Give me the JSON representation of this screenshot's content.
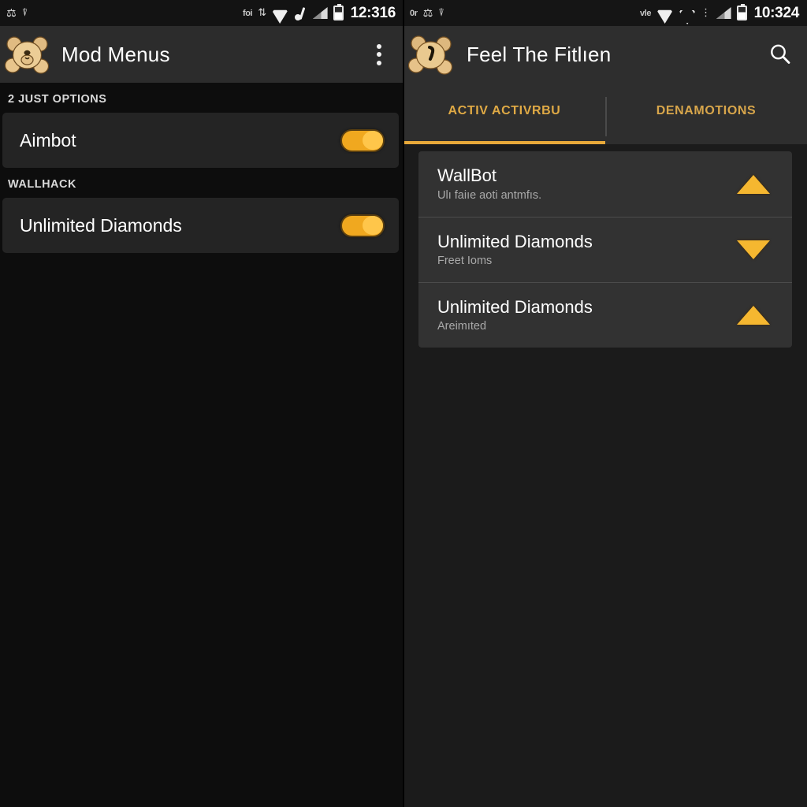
{
  "left_panel": {
    "status_bar": {
      "left_icons": [
        "usb-icon",
        "screenshot-icon"
      ],
      "right_icons": [
        "notification-glyph",
        "sync-icon",
        "wifi-icon",
        "bluetooth-icon",
        "signal-icon",
        "battery-icon"
      ],
      "notification_text": "foi",
      "clock": "12:316"
    },
    "app_bar": {
      "icon": "teddy-bear-icon",
      "title": "Mod Menus",
      "overflow_icon": "overflow-menu-icon"
    },
    "sections": [
      {
        "header": "2 JUST OPTIONS",
        "items": [
          {
            "label": "Aimbot",
            "toggle_on": true
          }
        ]
      },
      {
        "header": "WALLHACK",
        "items": [
          {
            "label": "Unlimited Diamonds",
            "toggle_on": true
          }
        ]
      }
    ]
  },
  "right_panel": {
    "status_bar": {
      "left_icons": [
        "usb-icon",
        "screenshot-icon"
      ],
      "left_text": "0r",
      "right_icons": [
        "notification-glyph",
        "wifi-icon",
        "wifi-outline-icon",
        "bars-icon",
        "signal-icon",
        "battery-icon"
      ],
      "notification_text": "vle",
      "clock": "10:324"
    },
    "app_bar": {
      "icon": "teddy-bear-icon",
      "title": "Feel The Fitlıen",
      "search_icon": "search-icon"
    },
    "tabs": [
      {
        "label": "ACTIV ACTIVRBU",
        "active": true
      },
      {
        "label": "DENAMOTIONS",
        "active": false
      }
    ],
    "list": [
      {
        "title": "WallBot",
        "subtitle": "Ulı faiıe aoti antmfıs.",
        "indicator": "up"
      },
      {
        "title": "Unlimited Diamonds",
        "subtitle": "Freet Ioms",
        "indicator": "down"
      },
      {
        "title": "Unlimited Diamonds",
        "subtitle": "Areimıted",
        "indicator": "up"
      }
    ]
  },
  "colors": {
    "accent_orange": "#f0a81f",
    "tab_text": "#e0aa45",
    "triangle": "#f5b730",
    "left_bg": "#0d0d0d",
    "right_bg": "#1b1b1b",
    "card_bg": "#242424",
    "row_bg": "#323232",
    "appbar_bg": "#2c2c2c"
  }
}
